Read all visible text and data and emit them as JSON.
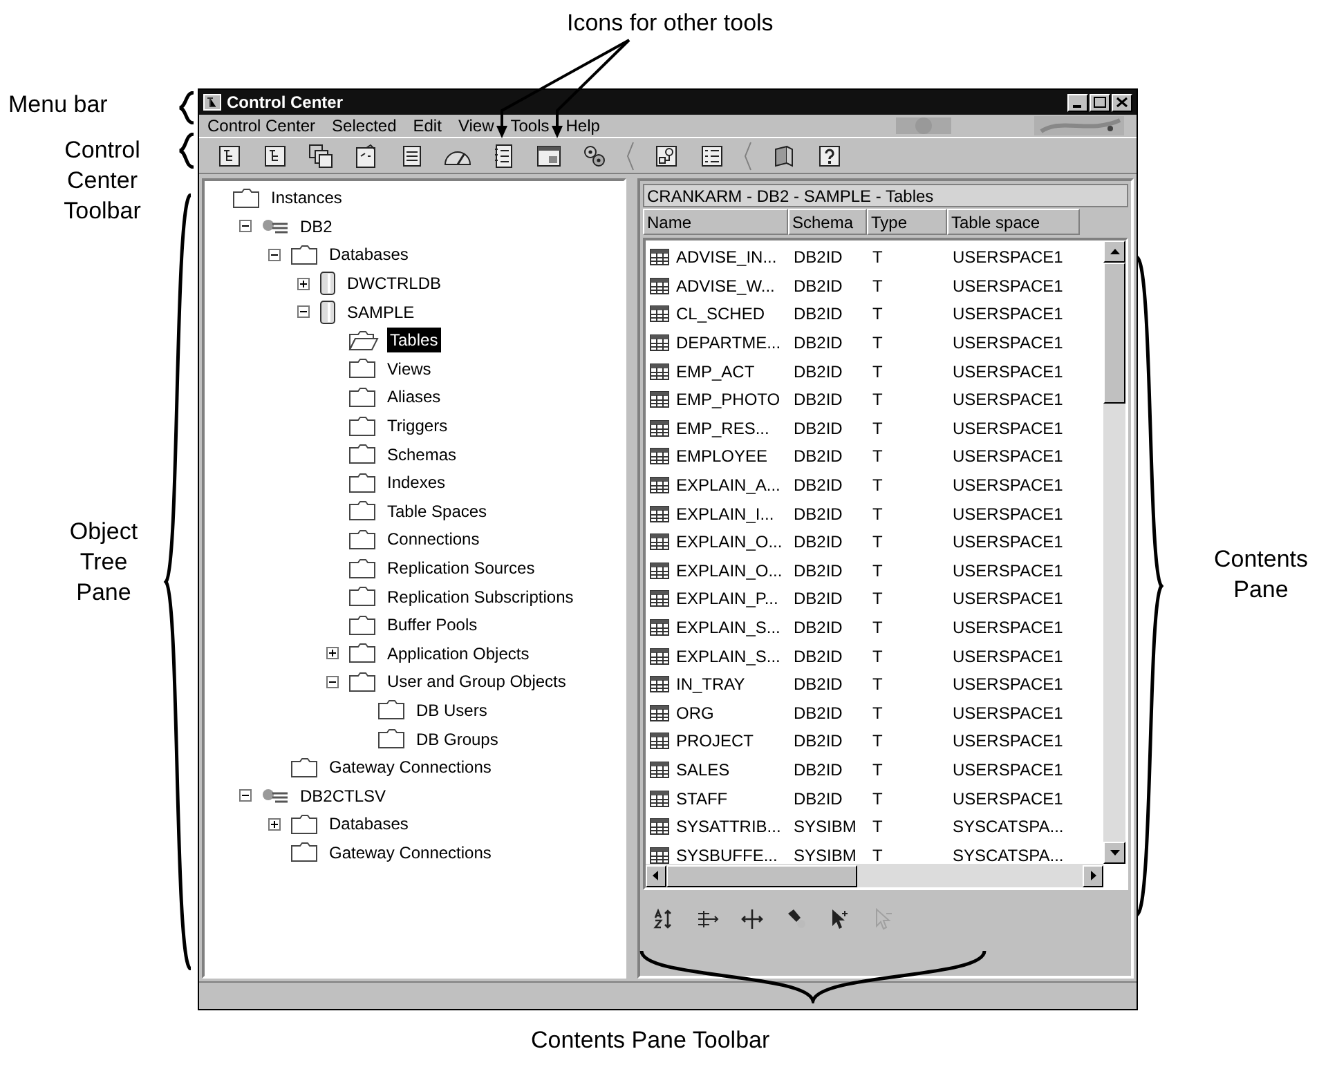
{
  "callouts": [
    {
      "text": "Icons for other tools"
    },
    {
      "text": "Menu bar"
    },
    {
      "text": "Control Center Toolbar"
    },
    {
      "text": "Object Tree Pane"
    },
    {
      "text": "Contents Pane"
    },
    {
      "text": "Contents Pane Toolbar"
    }
  ],
  "window": {
    "title": "Control Center"
  },
  "menu": [
    "Control Center",
    "Selected",
    "Edit",
    "View",
    "Tools",
    "Help"
  ],
  "toolbar": [
    {
      "kind": "tree"
    },
    {
      "kind": "tree"
    },
    {
      "kind": "stack"
    },
    {
      "kind": "script"
    },
    {
      "kind": "doc"
    },
    {
      "kind": "gauge"
    },
    {
      "kind": "notebook"
    },
    {
      "kind": "panel"
    },
    {
      "kind": "gears"
    },
    {
      "kind": "separator"
    },
    {
      "kind": "flow"
    },
    {
      "kind": "list"
    },
    {
      "kind": "separator"
    },
    {
      "kind": "book"
    },
    {
      "kind": "help"
    }
  ],
  "tree": [
    {
      "label": "Instances",
      "kind": "folder",
      "selected": false,
      "children": [
        {
          "label": "DB2",
          "kind": "instance",
          "expanded": true,
          "selected": false,
          "children": [
            {
              "label": "Databases",
              "kind": "folder",
              "expanded": true,
              "selected": false,
              "children": [
                {
                  "label": "DWCTRLDB",
                  "kind": "database",
                  "expanded": false,
                  "selected": false
                },
                {
                  "label": "SAMPLE",
                  "kind": "database",
                  "expanded": true,
                  "selected": false,
                  "children": [
                    {
                      "label": "Tables",
                      "kind": "open-folder",
                      "selected": true
                    },
                    {
                      "label": "Views",
                      "kind": "folder",
                      "selected": false
                    },
                    {
                      "label": "Aliases",
                      "kind": "folder",
                      "selected": false
                    },
                    {
                      "label": "Triggers",
                      "kind": "folder",
                      "selected": false
                    },
                    {
                      "label": "Schemas",
                      "kind": "folder",
                      "selected": false
                    },
                    {
                      "label": "Indexes",
                      "kind": "folder",
                      "selected": false
                    },
                    {
                      "label": "Table Spaces",
                      "kind": "folder",
                      "selected": false
                    },
                    {
                      "label": "Connections",
                      "kind": "folder",
                      "selected": false
                    },
                    {
                      "label": "Replication Sources",
                      "kind": "folder",
                      "selected": false
                    },
                    {
                      "label": "Replication Subscriptions",
                      "kind": "folder",
                      "selected": false
                    },
                    {
                      "label": "Buffer Pools",
                      "kind": "folder",
                      "selected": false
                    },
                    {
                      "label": "Application Objects",
                      "kind": "folder",
                      "expanded": false,
                      "selected": false
                    },
                    {
                      "label": "User and Group Objects",
                      "kind": "folder",
                      "expanded": true,
                      "selected": false,
                      "children": [
                        {
                          "label": "DB Users",
                          "kind": "folder",
                          "selected": false
                        },
                        {
                          "label": "DB Groups",
                          "kind": "folder",
                          "selected": false
                        }
                      ]
                    }
                  ]
                }
              ]
            },
            {
              "label": "Gateway Connections",
              "kind": "folder",
              "selected": false
            }
          ]
        },
        {
          "label": "DB2CTLSV",
          "kind": "instance",
          "expanded": true,
          "selected": false,
          "children": [
            {
              "label": "Databases",
              "kind": "folder",
              "expanded": false,
              "selected": false
            },
            {
              "label": "Gateway Connections",
              "kind": "folder",
              "selected": false
            }
          ]
        }
      ]
    }
  ],
  "contents": {
    "path": "CRANKARM - DB2 - SAMPLE - Tables",
    "columns": [
      "Name",
      "Schema",
      "Type",
      "Table space"
    ],
    "rows": [
      [
        "ADVISE_IN...",
        "DB2ID",
        "T",
        "USERSPACE1"
      ],
      [
        "ADVISE_W...",
        "DB2ID",
        "T",
        "USERSPACE1"
      ],
      [
        "CL_SCHED",
        "DB2ID",
        "T",
        "USERSPACE1"
      ],
      [
        "DEPARTME...",
        "DB2ID",
        "T",
        "USERSPACE1"
      ],
      [
        "EMP_ACT",
        "DB2ID",
        "T",
        "USERSPACE1"
      ],
      [
        "EMP_PHOTO",
        "DB2ID",
        "T",
        "USERSPACE1"
      ],
      [
        "EMP_RES...",
        "DB2ID",
        "T",
        "USERSPACE1"
      ],
      [
        "EMPLOYEE",
        "DB2ID",
        "T",
        "USERSPACE1"
      ],
      [
        "EXPLAIN_A...",
        "DB2ID",
        "T",
        "USERSPACE1"
      ],
      [
        "EXPLAIN_I...",
        "DB2ID",
        "T",
        "USERSPACE1"
      ],
      [
        "EXPLAIN_O...",
        "DB2ID",
        "T",
        "USERSPACE1"
      ],
      [
        "EXPLAIN_O...",
        "DB2ID",
        "T",
        "USERSPACE1"
      ],
      [
        "EXPLAIN_P...",
        "DB2ID",
        "T",
        "USERSPACE1"
      ],
      [
        "EXPLAIN_S...",
        "DB2ID",
        "T",
        "USERSPACE1"
      ],
      [
        "EXPLAIN_S...",
        "DB2ID",
        "T",
        "USERSPACE1"
      ],
      [
        "IN_TRAY",
        "DB2ID",
        "T",
        "USERSPACE1"
      ],
      [
        "ORG",
        "DB2ID",
        "T",
        "USERSPACE1"
      ],
      [
        "PROJECT",
        "DB2ID",
        "T",
        "USERSPACE1"
      ],
      [
        "SALES",
        "DB2ID",
        "T",
        "USERSPACE1"
      ],
      [
        "STAFF",
        "DB2ID",
        "T",
        "USERSPACE1"
      ],
      [
        "SYSATTRIB...",
        "SYSIBM",
        "T",
        "SYSCATSPA..."
      ],
      [
        "SYSBUFFE...",
        "SYSIBM",
        "T",
        "SYSCATSPA..."
      ]
    ],
    "toolbar": [
      {
        "kind": "sort",
        "disabled": false
      },
      {
        "kind": "filter",
        "disabled": false
      },
      {
        "kind": "columns",
        "disabled": false
      },
      {
        "kind": "find",
        "disabled": false
      },
      {
        "kind": "select-all",
        "disabled": false
      },
      {
        "kind": "deselect-all",
        "disabled": true
      }
    ]
  }
}
